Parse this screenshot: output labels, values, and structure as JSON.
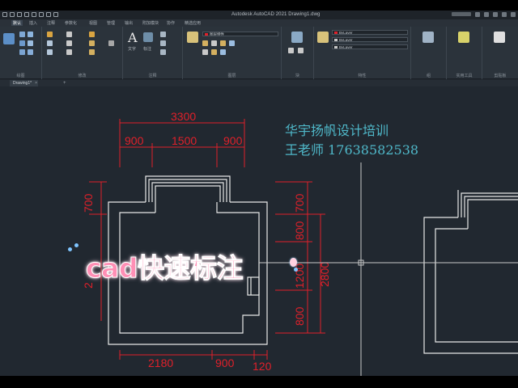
{
  "window": {
    "title": "Autodesk AutoCAD 2021   Drawing1.dwg"
  },
  "menu_tabs": [
    "默认",
    "插入",
    "注释",
    "参数化",
    "视图",
    "管理",
    "输出",
    "附加模块",
    "协作",
    "精选应用"
  ],
  "ribbon": {
    "panel_labels": [
      "绘图",
      "修改",
      "注释",
      "图层",
      "块",
      "特性",
      "组",
      "实用工具",
      "剪贴板"
    ],
    "text_label": "文字",
    "dimension_label": "标注",
    "layer_dropdown": "图层特性",
    "property_dropdowns": [
      "ByLayer",
      "ByLayer",
      "ByLayer"
    ]
  },
  "document_tabs": [
    {
      "label": "Drawing1*",
      "active": true
    }
  ],
  "drawing": {
    "dimensions_top": {
      "total": "3300",
      "segments": [
        "900",
        "1500",
        "900"
      ]
    },
    "dimensions_left": [
      "700",
      "2"
    ],
    "dimensions_right": [
      "700",
      "800",
      "1200",
      "800"
    ],
    "dimension_right_total": "2800",
    "dimensions_bottom": [
      "2180",
      "900",
      "120"
    ],
    "layer_color": "#e0202a",
    "line_color": "#e8e8e8",
    "crosshair_color": "#c8c8c8"
  },
  "watermark": {
    "line1": "华宇扬帆设计培训",
    "line2": "王老师  17638582538",
    "color": "#4fb8c9"
  },
  "caption": {
    "text": "cad快速标注",
    "color": "#ff8fb5"
  }
}
